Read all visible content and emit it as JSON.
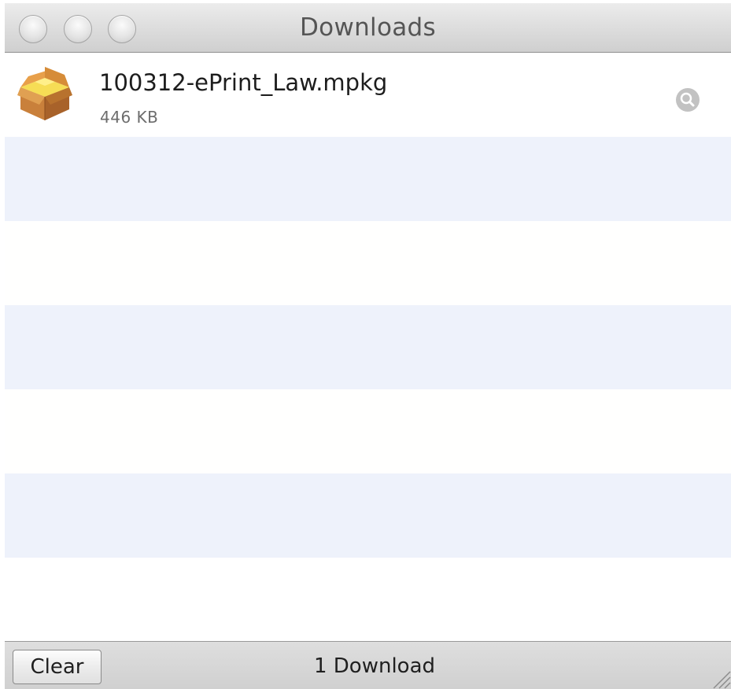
{
  "window": {
    "title": "Downloads"
  },
  "downloads": [
    {
      "name": "100312-ePrint_Law.mpkg",
      "size": "446 KB",
      "icon": "package-icon",
      "action_icon": "magnifier-icon"
    }
  ],
  "footer": {
    "clear_label": "Clear",
    "count_text": "1 Download"
  },
  "colors": {
    "row_alternate": "#eef2fb",
    "titlebar": "#dcdcdc",
    "footer": "#d6d6d6"
  }
}
